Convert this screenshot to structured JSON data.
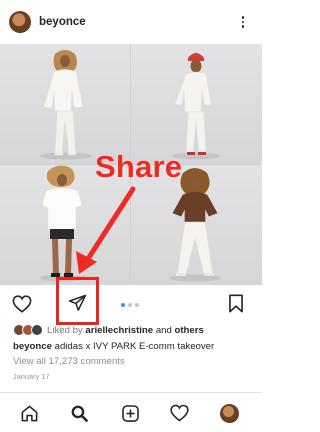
{
  "post": {
    "username": "beyonce",
    "liked_by_prefix": "Liked by",
    "liked_by_user": "ariellechristine",
    "liked_by_and": "and",
    "liked_by_others": "others",
    "caption_user": "beyonce",
    "caption_text": "adidas x IVY PARK E-comm takeover",
    "view_comments": "View all 17,273 comments",
    "date": "January 17"
  },
  "annotation": {
    "label": "Share",
    "color": "#ee2a24"
  },
  "carousel": {
    "total": 3,
    "active_index": 0
  },
  "icons": {
    "header_more": "more-vertical-icon",
    "like": "heart-icon",
    "share": "paper-plane-icon",
    "save": "bookmark-icon",
    "tabs": [
      "home-icon",
      "search-icon",
      "add-post-icon",
      "activity-heart-icon",
      "profile-avatar"
    ]
  },
  "colors": {
    "accent_blue": "#3897f0",
    "highlight_red": "#e8261f",
    "text": "#262626",
    "muted": "#8e8e8e"
  }
}
